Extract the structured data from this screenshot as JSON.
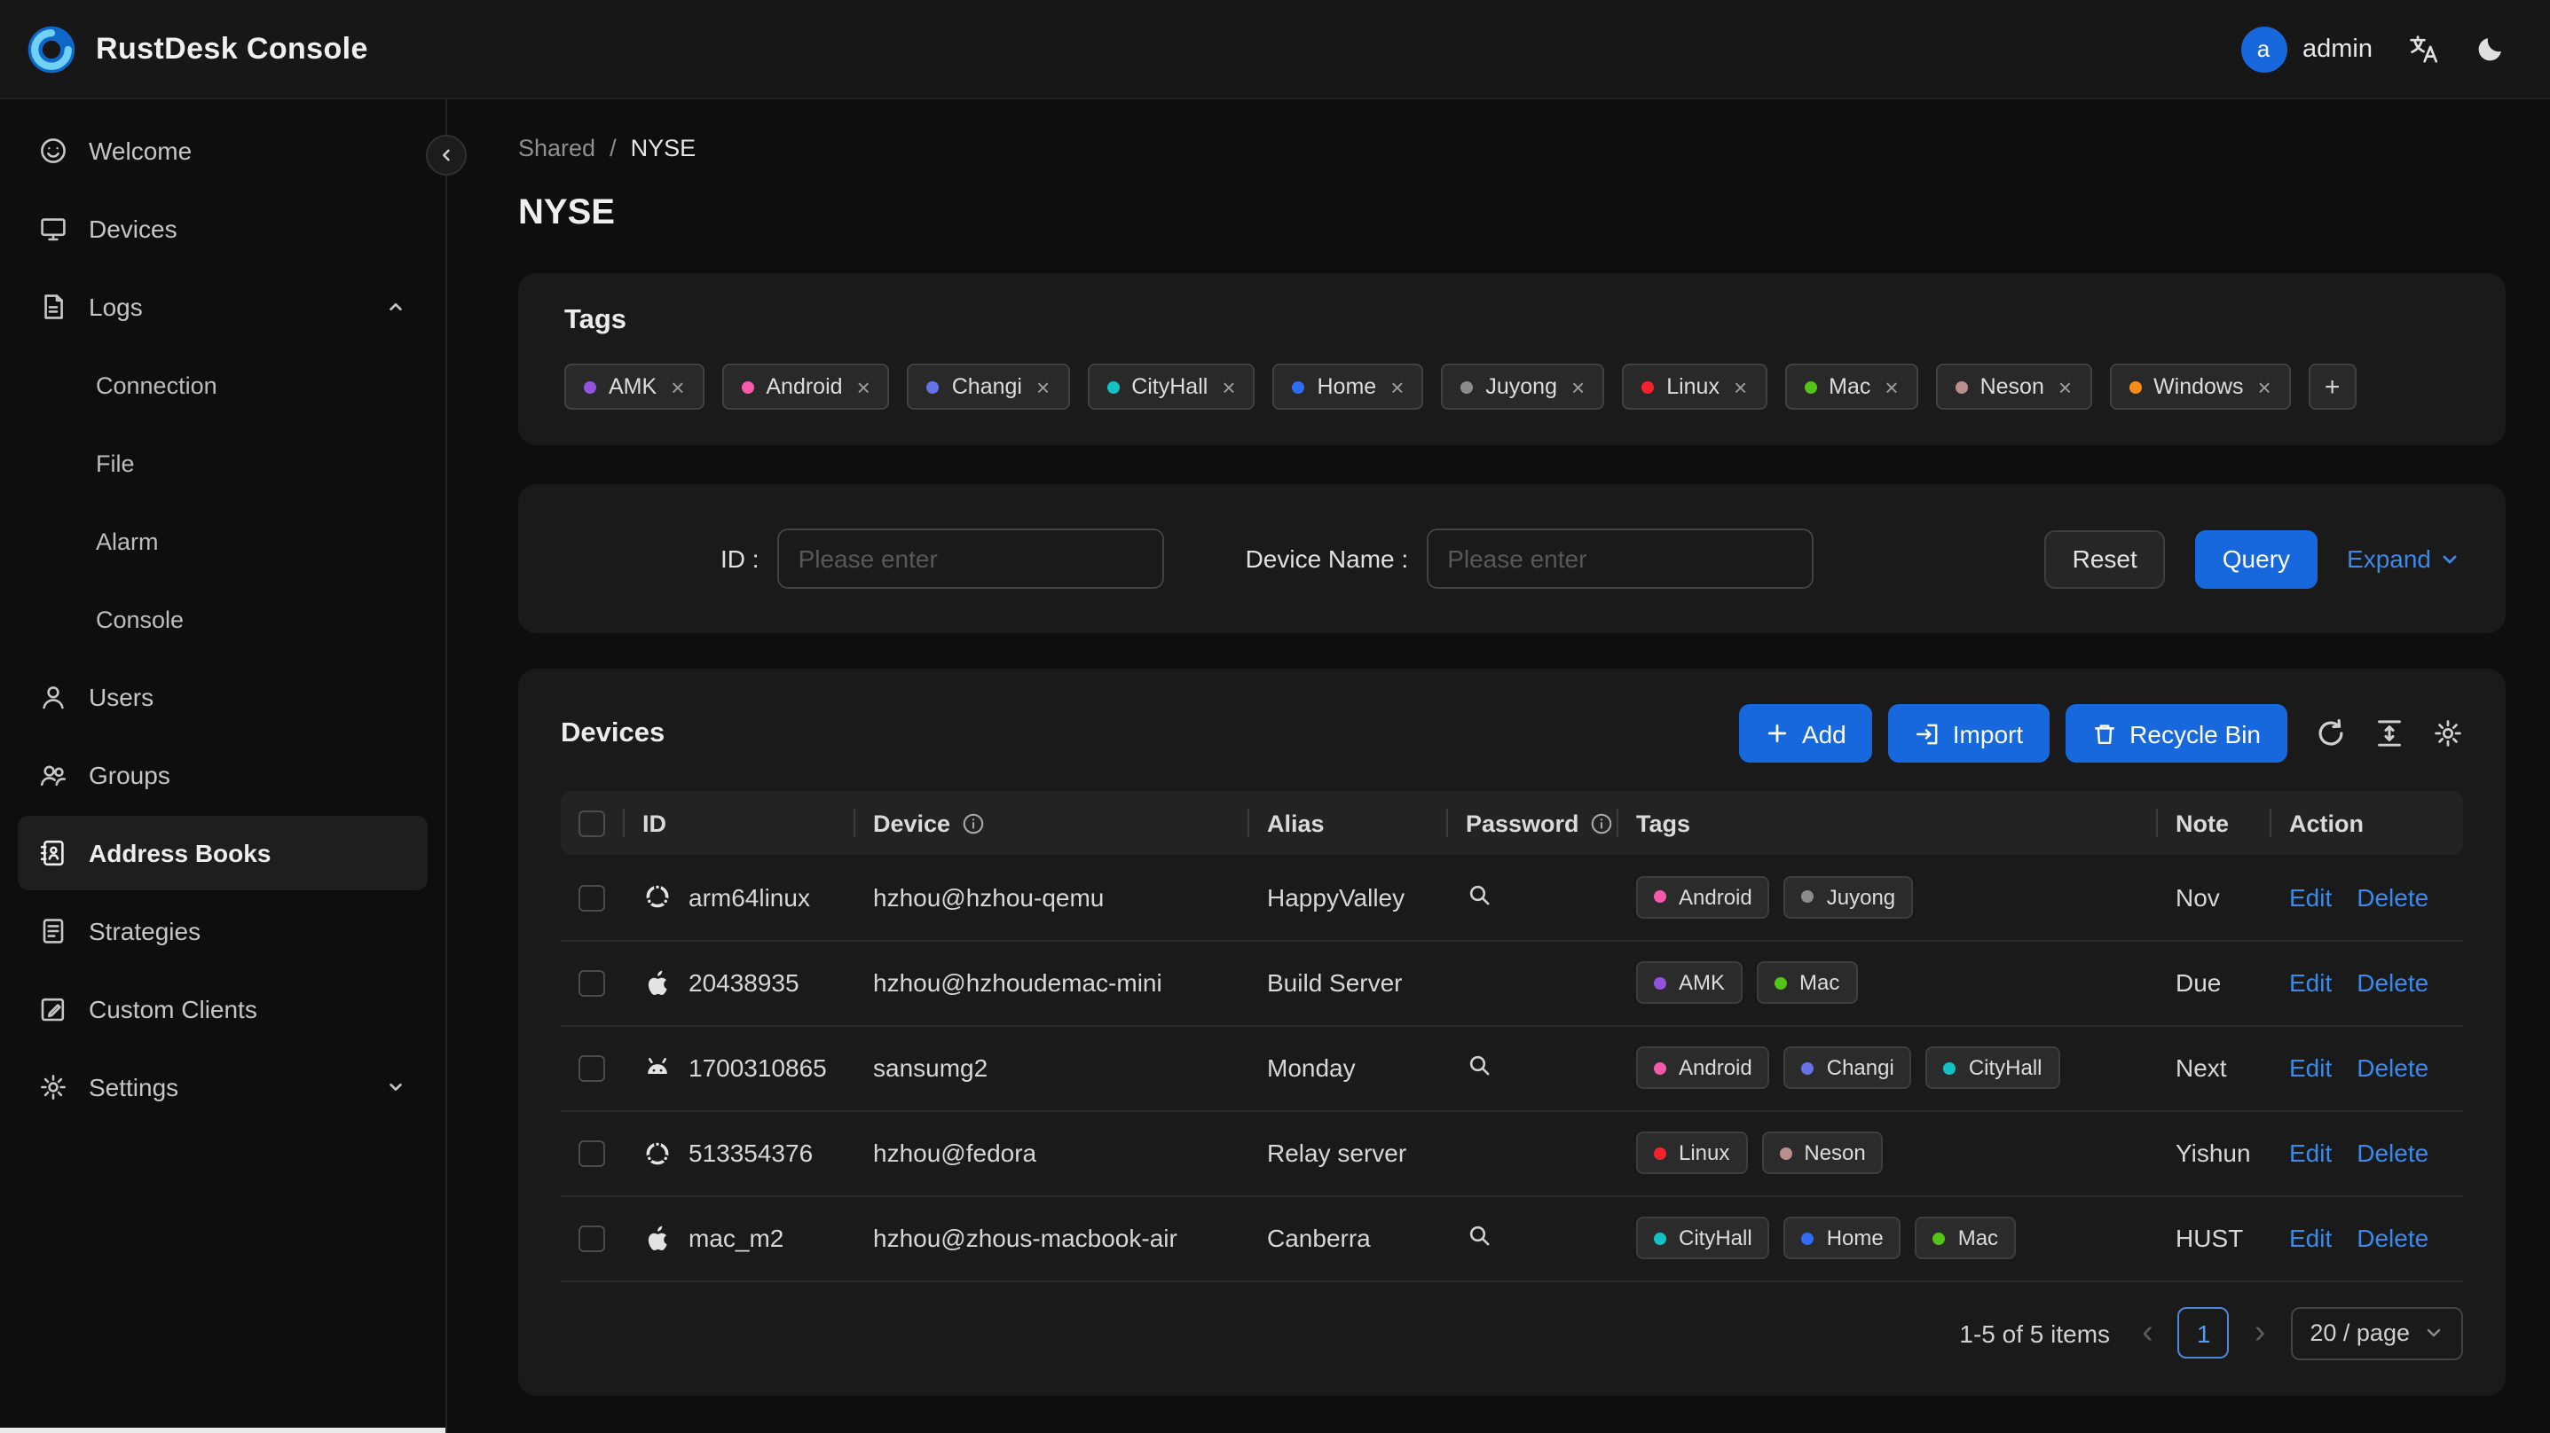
{
  "colors": {
    "primary": "#1668dc",
    "link": "#3c89e8"
  },
  "header": {
    "app_title": "RustDesk Console",
    "user": {
      "avatar_letter": "a",
      "name": "admin"
    },
    "action_icons": [
      "translate-icon",
      "moon-icon"
    ]
  },
  "sidebar": {
    "items": [
      {
        "label": "Welcome",
        "icon": "smile-icon"
      },
      {
        "label": "Devices",
        "icon": "monitor-icon"
      },
      {
        "label": "Logs",
        "icon": "logs-icon",
        "chevron": "up",
        "children": [
          "Connection",
          "File",
          "Alarm",
          "Console"
        ]
      },
      {
        "label": "Users",
        "icon": "user-icon"
      },
      {
        "label": "Groups",
        "icon": "group-icon"
      },
      {
        "label": "Address Books",
        "icon": "address-book-icon",
        "active": true
      },
      {
        "label": "Strategies",
        "icon": "strategy-icon"
      },
      {
        "label": "Custom Clients",
        "icon": "custom-client-icon"
      },
      {
        "label": "Settings",
        "icon": "settings-icon",
        "chevron": "down"
      }
    ]
  },
  "breadcrumb": {
    "parent": "Shared",
    "separator": "/",
    "current": "NYSE"
  },
  "page": {
    "title": "NYSE"
  },
  "tags_card": {
    "title": "Tags",
    "add_label": "+",
    "tags": [
      {
        "label": "AMK",
        "color": "#9254de"
      },
      {
        "label": "Android",
        "color": "#f759ab"
      },
      {
        "label": "Changi",
        "color": "#6672e8"
      },
      {
        "label": "CityHall",
        "color": "#13c2c2"
      },
      {
        "label": "Home",
        "color": "#2e6cf6"
      },
      {
        "label": "Juyong",
        "color": "#8c8c8c"
      },
      {
        "label": "Linux",
        "color": "#f5222d"
      },
      {
        "label": "Mac",
        "color": "#52c41a"
      },
      {
        "label": "Neson",
        "color": "#bc8f8f"
      },
      {
        "label": "Windows",
        "color": "#fa8c16"
      }
    ]
  },
  "filter": {
    "id_label": "ID :",
    "id_placeholder": "Please enter",
    "device_name_label": "Device Name :",
    "device_name_placeholder": "Please enter",
    "reset_label": "Reset",
    "query_label": "Query",
    "expand_label": "Expand"
  },
  "devices": {
    "title": "Devices",
    "add_label": "Add",
    "import_label": "Import",
    "recycle_bin_label": "Recycle Bin",
    "tool_icons": [
      "refresh-icon",
      "column-height-icon",
      "settings-icon"
    ],
    "columns": [
      {
        "label": "ID"
      },
      {
        "label": "Device",
        "info": true
      },
      {
        "label": "Alias"
      },
      {
        "label": "Password",
        "info": true
      },
      {
        "label": "Tags"
      },
      {
        "label": "Note"
      },
      {
        "label": "Action"
      }
    ],
    "edit_label": "Edit",
    "delete_label": "Delete",
    "rows": [
      {
        "os": "linux-icon",
        "id": "arm64linux",
        "device": "hzhou@hzhou-qemu",
        "alias": "HappyValley",
        "has_password": true,
        "tags": [
          {
            "label": "Android",
            "color": "#f759ab"
          },
          {
            "label": "Juyong",
            "color": "#8c8c8c"
          }
        ],
        "note": "Nov"
      },
      {
        "os": "apple-icon",
        "id": "20438935",
        "device": "hzhou@hzhoudemac-mini",
        "alias": "Build Server",
        "has_password": false,
        "tags": [
          {
            "label": "AMK",
            "color": "#9254de"
          },
          {
            "label": "Mac",
            "color": "#52c41a"
          }
        ],
        "note": "Due"
      },
      {
        "os": "android-icon",
        "id": "1700310865",
        "device": "sansumg2",
        "alias": "Monday",
        "has_password": true,
        "tags": [
          {
            "label": "Android",
            "color": "#f759ab"
          },
          {
            "label": "Changi",
            "color": "#6672e8"
          },
          {
            "label": "CityHall",
            "color": "#13c2c2"
          }
        ],
        "note": "Next"
      },
      {
        "os": "linux-icon",
        "id": "513354376",
        "device": "hzhou@fedora",
        "alias": "Relay server",
        "has_password": false,
        "tags": [
          {
            "label": "Linux",
            "color": "#f5222d"
          },
          {
            "label": "Neson",
            "color": "#bc8f8f"
          }
        ],
        "note": "Yishun"
      },
      {
        "os": "apple-icon",
        "id": "mac_m2",
        "device": "hzhou@zhous-macbook-air",
        "alias": "Canberra",
        "has_password": true,
        "tags": [
          {
            "label": "CityHall",
            "color": "#13c2c2"
          },
          {
            "label": "Home",
            "color": "#2e6cf6"
          },
          {
            "label": "Mac",
            "color": "#52c41a"
          }
        ],
        "note": "HUST"
      }
    ],
    "pagination": {
      "summary": "1-5 of 5 items",
      "page": "1",
      "page_size": "20 / page"
    }
  }
}
